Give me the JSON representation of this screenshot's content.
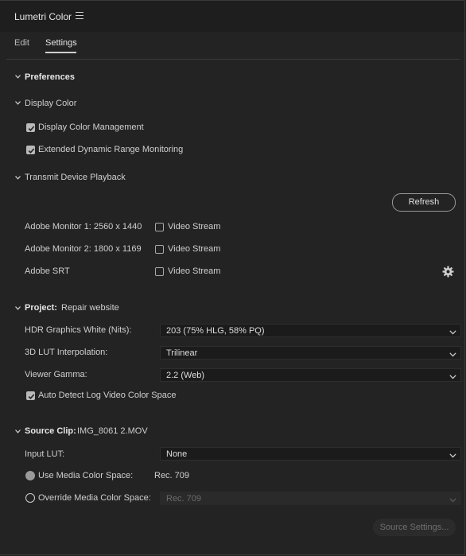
{
  "panel": {
    "title": "Lumetri Color"
  },
  "tabs": [
    {
      "label": "Edit"
    },
    {
      "label": "Settings"
    }
  ],
  "preferences": {
    "heading": "Preferences",
    "display_color": {
      "heading": "Display Color",
      "items": [
        {
          "label": "Display Color Management",
          "checked": true
        },
        {
          "label": "Extended Dynamic Range Monitoring",
          "checked": true
        }
      ]
    },
    "transmit": {
      "heading": "Transmit Device Playback",
      "refresh_label": "Refresh",
      "devices": [
        {
          "name": "Adobe Monitor 1: 2560 x 1440",
          "option": "Video Stream",
          "checked": false
        },
        {
          "name": "Adobe Monitor 2: 1800 x 1169",
          "option": "Video Stream",
          "checked": false
        },
        {
          "name": "Adobe SRT",
          "option": "Video Stream",
          "checked": false
        }
      ]
    }
  },
  "project": {
    "heading": "Project:",
    "name": "Repair website",
    "rows": [
      {
        "label": "HDR Graphics White (Nits):",
        "value": "203 (75% HLG, 58% PQ)"
      },
      {
        "label": "3D LUT Interpolation:",
        "value": "Trilinear"
      },
      {
        "label": "Viewer Gamma:",
        "value": "2.2 (Web)"
      }
    ],
    "auto_detect": {
      "label": "Auto Detect Log Video Color Space",
      "checked": true
    }
  },
  "source_clip": {
    "heading": "Source Clip:",
    "name": "IMG_8061 2.MOV",
    "input_lut": {
      "label": "Input LUT:",
      "value": "None"
    },
    "use_media": {
      "label": "Use Media Color Space:",
      "value": "Rec. 709",
      "selected": true
    },
    "override_media": {
      "label": "Override Media Color Space:",
      "value": "Rec. 709",
      "selected": false
    },
    "source_settings_label": "Source Settings..."
  },
  "colors": {
    "panel_bg": "#232323",
    "title_bg": "#1e1e1e",
    "text": "#cfcfcf",
    "dropdown_bg": "#1b1b1b"
  }
}
